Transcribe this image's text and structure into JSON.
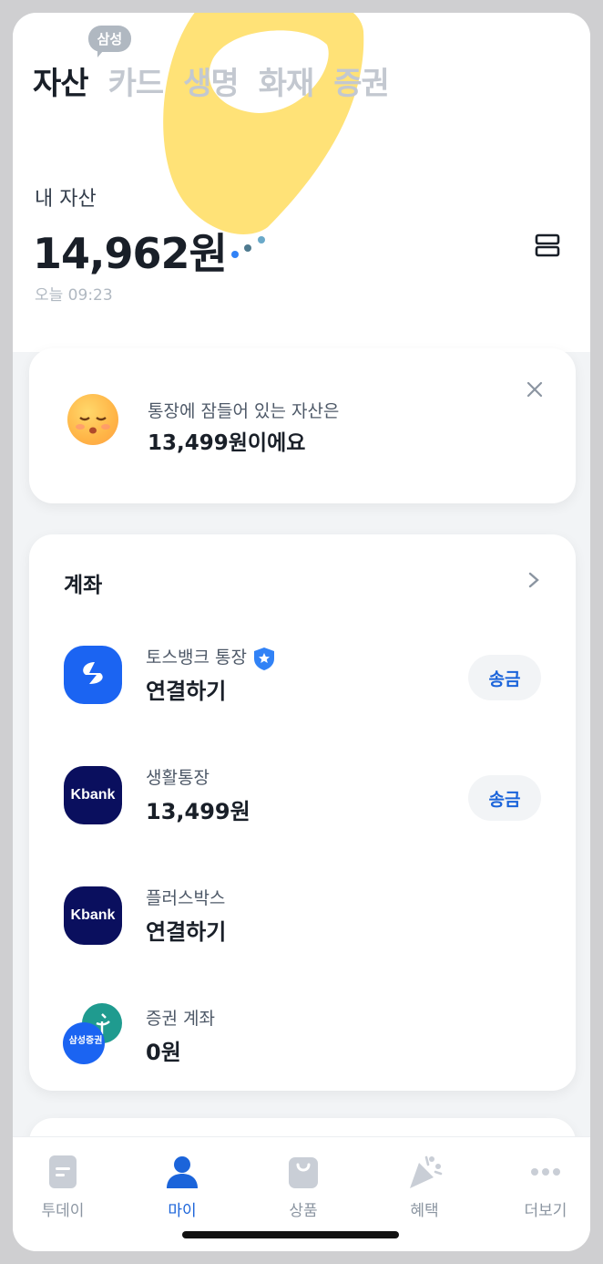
{
  "tabs": [
    {
      "label": "자산",
      "active": true
    },
    {
      "label": "카드",
      "badge": "삼성"
    },
    {
      "label": "생명"
    },
    {
      "label": "화재"
    },
    {
      "label": "증권"
    }
  ],
  "my_assets": {
    "label": "내 자산",
    "value": "14,962원",
    "updated": "오늘 09:23"
  },
  "notice": {
    "line1": "통장에 잠들어 있는 자산은",
    "line2": "13,499원이에요"
  },
  "accounts": {
    "title": "계좌",
    "items": [
      {
        "name": "토스뱅크 통장",
        "value": "연결하기",
        "action": "송금",
        "logo": "toss-bank"
      },
      {
        "name": "생활통장",
        "value": "13,499원",
        "action": "송금",
        "logo": "Kbank"
      },
      {
        "name": "플러스박스",
        "value": "연결하기",
        "logo": "Kbank"
      },
      {
        "name": "증권 계좌",
        "value": "0원",
        "logo": "삼성증권"
      }
    ]
  },
  "nav": [
    {
      "label": "투데이",
      "icon": "today-icon"
    },
    {
      "label": "마이",
      "icon": "person-icon",
      "active": true
    },
    {
      "label": "상품",
      "icon": "bag-icon"
    },
    {
      "label": "혜택",
      "icon": "party-icon"
    },
    {
      "label": "더보기",
      "icon": "more-icon"
    }
  ],
  "colors": {
    "accent": "#1b64da",
    "kbank": "#0a0f5e",
    "toss": "#1b64f2"
  }
}
